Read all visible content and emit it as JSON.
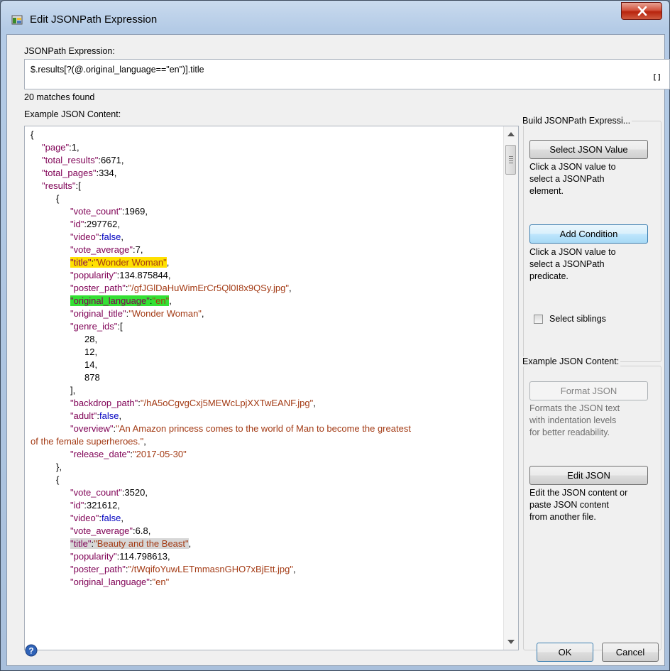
{
  "window": {
    "title": "Edit JSONPath Expression"
  },
  "expression": {
    "label": "JSONPath Expression:",
    "value": "$.results[?(@.original_language==\"en\")].title",
    "bracket_button": "[]"
  },
  "matches": "20 matches found",
  "example": {
    "label": "Example JSON Content:"
  },
  "code_lines": [
    {
      "i": 0,
      "t": [
        {
          "c": "",
          "v": "{"
        }
      ]
    },
    {
      "i": 1,
      "t": [
        {
          "c": "k",
          "v": "\"page\""
        },
        {
          "c": "",
          "v": ":1,"
        }
      ]
    },
    {
      "i": 1,
      "t": [
        {
          "c": "k",
          "v": "\"total_results\""
        },
        {
          "c": "",
          "v": ":6671,"
        }
      ]
    },
    {
      "i": 1,
      "t": [
        {
          "c": "k",
          "v": "\"total_pages\""
        },
        {
          "c": "",
          "v": ":334,"
        }
      ]
    },
    {
      "i": 1,
      "t": [
        {
          "c": "k",
          "v": "\"results\""
        },
        {
          "c": "",
          "v": ":["
        }
      ]
    },
    {
      "i": 2,
      "t": [
        {
          "c": "",
          "v": "{"
        }
      ]
    },
    {
      "i": 3,
      "t": [
        {
          "c": "k",
          "v": "\"vote_count\""
        },
        {
          "c": "",
          "v": ":1969,"
        }
      ]
    },
    {
      "i": 3,
      "t": [
        {
          "c": "k",
          "v": "\"id\""
        },
        {
          "c": "",
          "v": ":297762,"
        }
      ]
    },
    {
      "i": 3,
      "t": [
        {
          "c": "k",
          "v": "\"video\""
        },
        {
          "c": "",
          "v": ":"
        },
        {
          "c": "b",
          "v": "false"
        },
        {
          "c": "",
          "v": ","
        }
      ]
    },
    {
      "i": 3,
      "t": [
        {
          "c": "k",
          "v": "\"vote_average\""
        },
        {
          "c": "",
          "v": ":7,"
        }
      ]
    },
    {
      "i": 3,
      "hl": "hl-yellow",
      "t": [
        {
          "c": "k",
          "v": "\"title\""
        },
        {
          "c": "",
          "v": ":"
        },
        {
          "c": "s",
          "v": "\"Wonder Woman\""
        }
      ],
      "after": ","
    },
    {
      "i": 3,
      "t": [
        {
          "c": "k",
          "v": "\"popularity\""
        },
        {
          "c": "",
          "v": ":134.875844,"
        }
      ]
    },
    {
      "i": 3,
      "t": [
        {
          "c": "k",
          "v": "\"poster_path\""
        },
        {
          "c": "",
          "v": ":"
        },
        {
          "c": "s",
          "v": "\"/gfJGlDaHuWimErCr5Ql0I8x9QSy.jpg\""
        },
        {
          "c": "",
          "v": ","
        }
      ]
    },
    {
      "i": 3,
      "hl": "hl-green",
      "t": [
        {
          "c": "k",
          "v": "\"original_language\""
        },
        {
          "c": "",
          "v": ":"
        },
        {
          "c": "s",
          "v": "\"en\""
        }
      ],
      "after": ","
    },
    {
      "i": 3,
      "t": [
        {
          "c": "k",
          "v": "\"original_title\""
        },
        {
          "c": "",
          "v": ":"
        },
        {
          "c": "s",
          "v": "\"Wonder Woman\""
        },
        {
          "c": "",
          "v": ","
        }
      ]
    },
    {
      "i": 3,
      "t": [
        {
          "c": "k",
          "v": "\"genre_ids\""
        },
        {
          "c": "",
          "v": ":["
        }
      ]
    },
    {
      "i": 4,
      "t": [
        {
          "c": "",
          "v": "28,"
        }
      ]
    },
    {
      "i": 4,
      "t": [
        {
          "c": "",
          "v": "12,"
        }
      ]
    },
    {
      "i": 4,
      "t": [
        {
          "c": "",
          "v": "14,"
        }
      ]
    },
    {
      "i": 4,
      "t": [
        {
          "c": "",
          "v": "878"
        }
      ]
    },
    {
      "i": 3,
      "t": [
        {
          "c": "",
          "v": "],"
        }
      ]
    },
    {
      "i": 3,
      "t": [
        {
          "c": "k",
          "v": "\"backdrop_path\""
        },
        {
          "c": "",
          "v": ":"
        },
        {
          "c": "s",
          "v": "\"/hA5oCgvgCxj5MEWcLpjXXTwEANF.jpg\""
        },
        {
          "c": "",
          "v": ","
        }
      ]
    },
    {
      "i": 3,
      "t": [
        {
          "c": "k",
          "v": "\"adult\""
        },
        {
          "c": "",
          "v": ":"
        },
        {
          "c": "b",
          "v": "false"
        },
        {
          "c": "",
          "v": ","
        }
      ]
    },
    {
      "i": 3,
      "t": [
        {
          "c": "k",
          "v": "\"overview\""
        },
        {
          "c": "",
          "v": ":"
        },
        {
          "c": "s",
          "v": "\"An Amazon princess comes to the world of Man to become the greatest"
        }
      ]
    },
    {
      "i": 0,
      "t": [
        {
          "c": "s",
          "v": "of the female superheroes.\""
        },
        {
          "c": "",
          "v": ","
        }
      ]
    },
    {
      "i": 3,
      "t": [
        {
          "c": "k",
          "v": "\"release_date\""
        },
        {
          "c": "",
          "v": ":"
        },
        {
          "c": "s",
          "v": "\"2017-05-30\""
        }
      ]
    },
    {
      "i": 2,
      "t": [
        {
          "c": "",
          "v": "},"
        }
      ]
    },
    {
      "i": 2,
      "t": [
        {
          "c": "",
          "v": "{"
        }
      ]
    },
    {
      "i": 3,
      "t": [
        {
          "c": "k",
          "v": "\"vote_count\""
        },
        {
          "c": "",
          "v": ":3520,"
        }
      ]
    },
    {
      "i": 3,
      "t": [
        {
          "c": "k",
          "v": "\"id\""
        },
        {
          "c": "",
          "v": ":321612,"
        }
      ]
    },
    {
      "i": 3,
      "t": [
        {
          "c": "k",
          "v": "\"video\""
        },
        {
          "c": "",
          "v": ":"
        },
        {
          "c": "b",
          "v": "false"
        },
        {
          "c": "",
          "v": ","
        }
      ]
    },
    {
      "i": 3,
      "t": [
        {
          "c": "k",
          "v": "\"vote_average\""
        },
        {
          "c": "",
          "v": ":6.8,"
        }
      ]
    },
    {
      "i": 3,
      "hl": "hl-gray",
      "t": [
        {
          "c": "k",
          "v": "\"title\""
        },
        {
          "c": "",
          "v": ":"
        },
        {
          "c": "s",
          "v": "\"Beauty and the Beast\""
        }
      ],
      "after": ","
    },
    {
      "i": 3,
      "t": [
        {
          "c": "k",
          "v": "\"popularity\""
        },
        {
          "c": "",
          "v": ":114.798613,"
        }
      ]
    },
    {
      "i": 3,
      "t": [
        {
          "c": "k",
          "v": "\"poster_path\""
        },
        {
          "c": "",
          "v": ":"
        },
        {
          "c": "s",
          "v": "\"/tWqifoYuwLETmmasnGHO7xBjEtt.jpg\""
        },
        {
          "c": "",
          "v": ","
        }
      ]
    },
    {
      "i": 3,
      "t": [
        {
          "c": "k",
          "v": "\"original_language\""
        },
        {
          "c": "",
          "v": ":"
        },
        {
          "c": "s",
          "v": "\"en\""
        }
      ]
    }
  ],
  "build_group": {
    "title": "Build JSONPath Expressi...",
    "select_value_button": "Select JSON Value",
    "select_value_desc": [
      "Click a JSON value to",
      "select a JSONPath",
      "element."
    ],
    "add_condition_button": "Add Condition",
    "add_condition_desc": [
      "Click a JSON value to",
      "select a JSONPath",
      "predicate."
    ],
    "select_siblings_label": "Select siblings"
  },
  "example_group": {
    "title": "Example JSON Content:",
    "format_button": "Format JSON",
    "format_desc": [
      "Formats the JSON text",
      "with indentation levels",
      "for better readability."
    ],
    "edit_button": "Edit JSON",
    "edit_desc": [
      "Edit the JSON content or",
      "paste JSON content",
      "from another file."
    ]
  },
  "footer": {
    "ok": "OK",
    "cancel": "Cancel"
  },
  "colors": {
    "key": "#7f0055",
    "string": "#a33a14",
    "boolean": "#0000c0",
    "highlight_title": "#ffe000",
    "highlight_language": "#34e034",
    "highlight_other": "#d7d7d7"
  }
}
